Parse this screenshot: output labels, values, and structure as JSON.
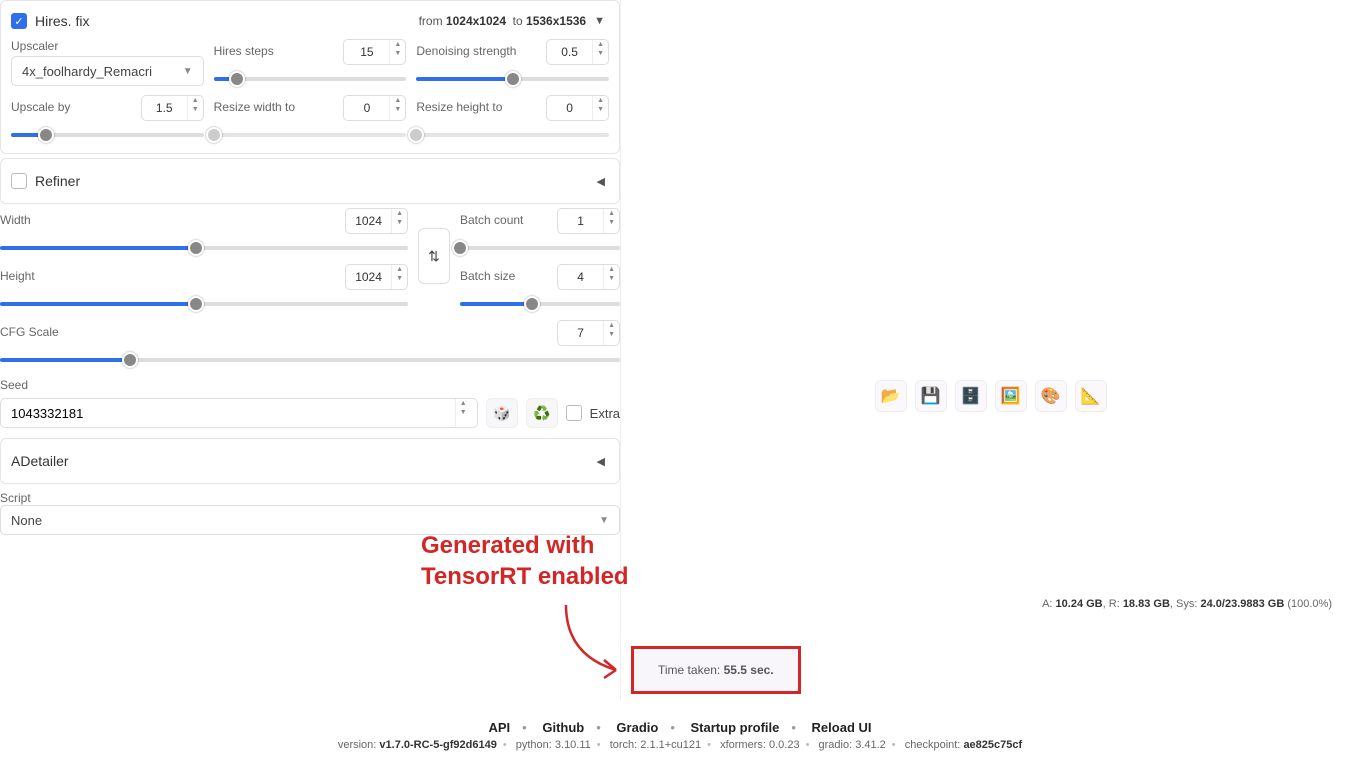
{
  "hires": {
    "title": "Hires. fix",
    "from_label": "from",
    "from_dim": "1024x1024",
    "to_label": "to",
    "to_dim": "1536x1536",
    "upscaler_label": "Upscaler",
    "upscaler_value": "4x_foolhardy_Remacri",
    "hires_steps_label": "Hires steps",
    "hires_steps_value": "15",
    "denoise_label": "Denoising strength",
    "denoise_value": "0.5",
    "upscale_by_label": "Upscale by",
    "upscale_by_value": "1.5",
    "resize_w_label": "Resize width to",
    "resize_w_value": "0",
    "resize_h_label": "Resize height to",
    "resize_h_value": "0"
  },
  "refiner": {
    "title": "Refiner"
  },
  "dims": {
    "width_label": "Width",
    "width_value": "1024",
    "height_label": "Height",
    "height_value": "1024",
    "batch_count_label": "Batch count",
    "batch_count_value": "1",
    "batch_size_label": "Batch size",
    "batch_size_value": "4",
    "cfg_label": "CFG Scale",
    "cfg_value": "7"
  },
  "seed": {
    "label": "Seed",
    "value": "1043332181",
    "extra_label": "Extra"
  },
  "adetailer": {
    "title": "ADetailer"
  },
  "script": {
    "label": "Script",
    "value": "None"
  },
  "annotation": {
    "line1": "Generated with",
    "line2": "TensorRT enabled"
  },
  "time": {
    "label": "Time taken:",
    "value": "55.5 sec."
  },
  "mem": {
    "a_label": "A:",
    "a_val": "10.24 GB",
    "r_label": "R:",
    "r_val": "18.83 GB",
    "sys_label": "Sys:",
    "sys_val": "24.0/23.9883 GB",
    "pct": "(100.0%)"
  },
  "footer": {
    "links": [
      "API",
      "Github",
      "Gradio",
      "Startup profile",
      "Reload UI"
    ],
    "version_prefix": "version:",
    "version": "v1.7.0-RC-5-gf92d6149",
    "python_prefix": "python:",
    "python": "3.10.11",
    "torch_prefix": "torch:",
    "torch": "2.1.1+cu121",
    "xformers_prefix": "xformers:",
    "xformers": "0.0.23",
    "gradio_prefix": "gradio:",
    "gradio": "3.41.2",
    "checkpoint_prefix": "checkpoint:",
    "checkpoint": "ae825c75cf"
  }
}
